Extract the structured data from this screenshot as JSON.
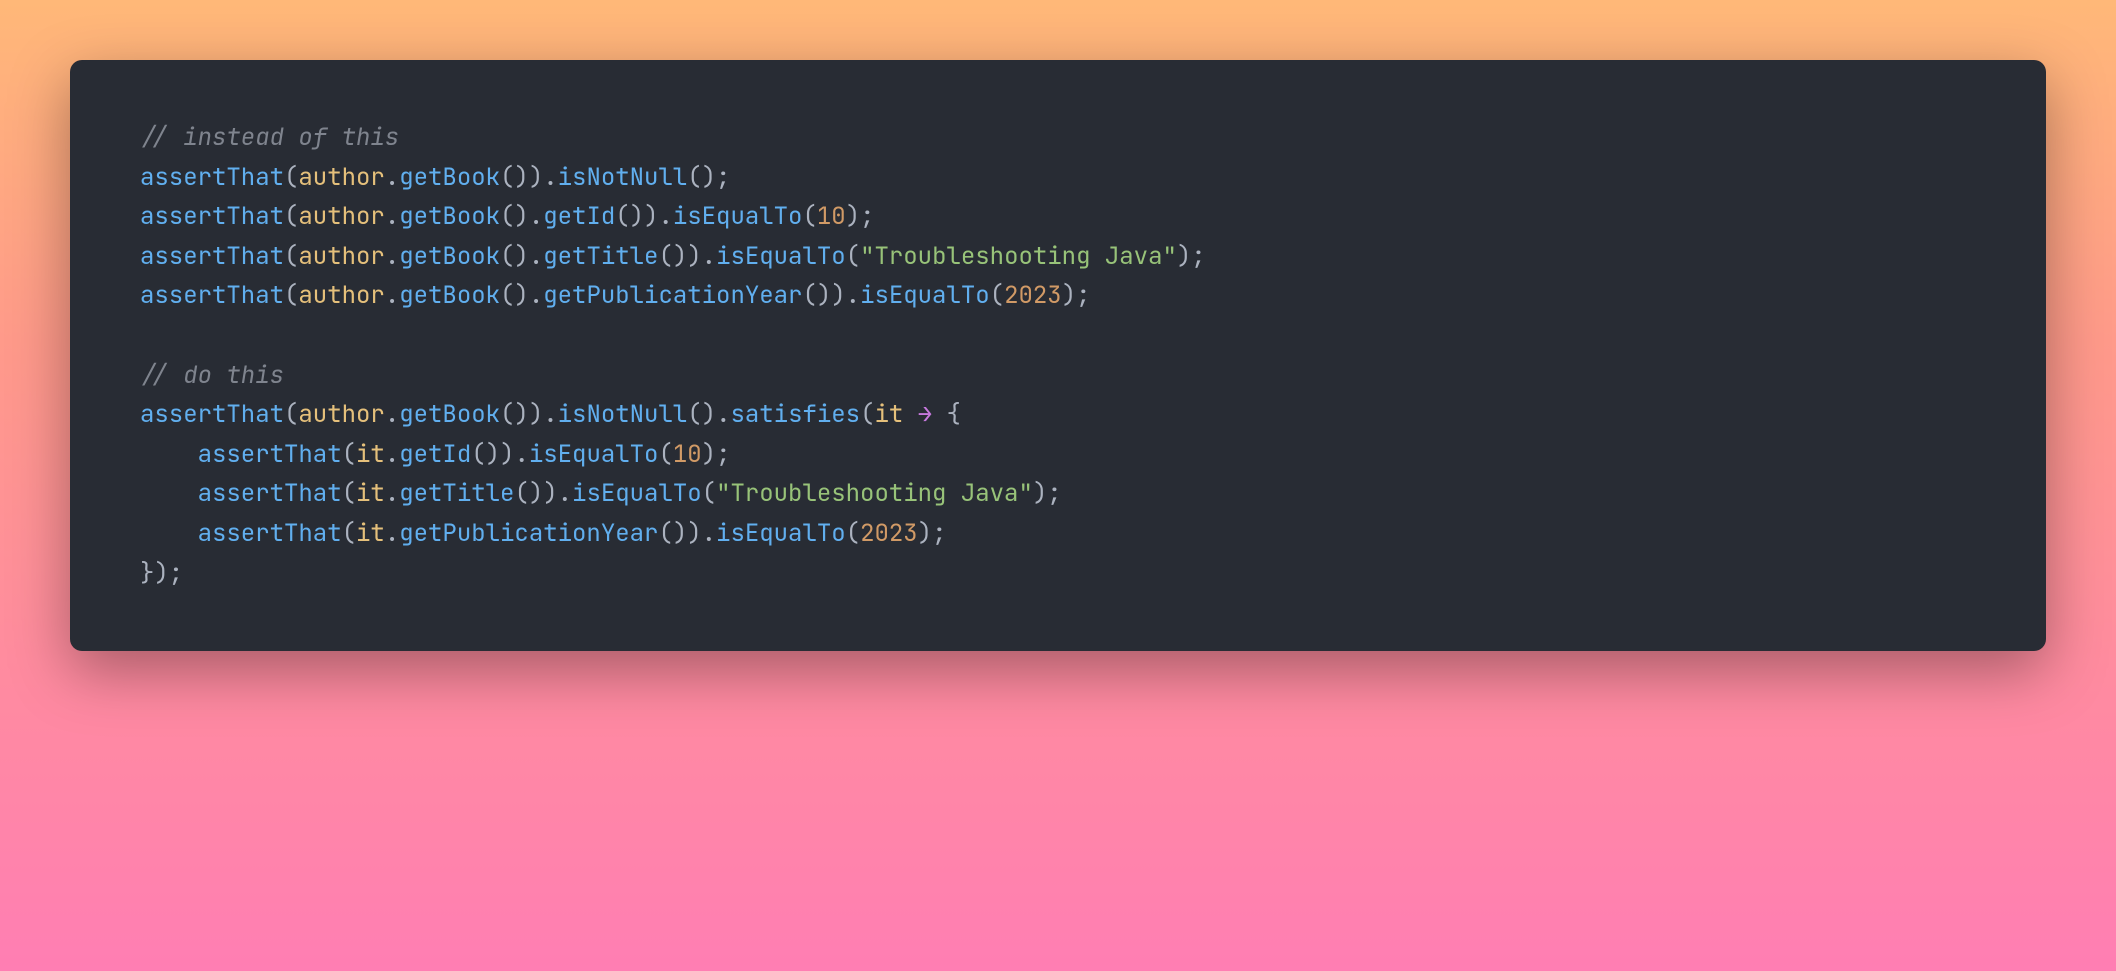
{
  "code": {
    "comment1": "// instead of this",
    "comment2": "// do this",
    "assertThat": "assertThat",
    "author": "author",
    "it": "it",
    "getBook": "getBook",
    "getId": "getId",
    "getTitle": "getTitle",
    "getPublicationYear": "getPublicationYear",
    "isNotNull": "isNotNull",
    "isEqualTo": "isEqualTo",
    "satisfies": "satisfies",
    "num10": "10",
    "num2023": "2023",
    "strTitle": "\"Troubleshooting Java\"",
    "arrow": "→",
    "dot": ".",
    "lp": "(",
    "rp": ")",
    "lb": "{",
    "rb": "}",
    "sc": ";",
    "sp": " "
  }
}
